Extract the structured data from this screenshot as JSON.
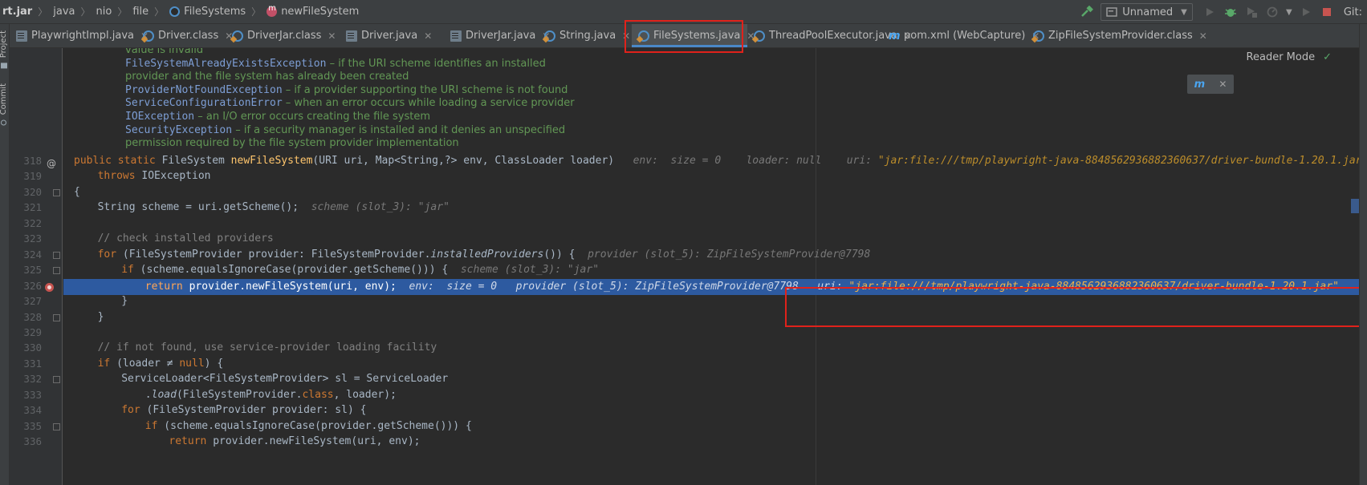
{
  "breadcrumb": [
    "rt.jar",
    "java",
    "nio",
    "file",
    "FileSystems",
    "newFileSystem"
  ],
  "toolbar": {
    "run_config": "Unnamed",
    "git_label": "Git:"
  },
  "side_labels": {
    "project": "Project",
    "commit": "Commit"
  },
  "tabs": [
    {
      "label": "PlaywrightImpl.java",
      "icon": "file"
    },
    {
      "label": "Driver.class",
      "icon": "java"
    },
    {
      "label": "DriverJar.class",
      "icon": "java"
    },
    {
      "label": "Driver.java",
      "icon": "file"
    },
    {
      "label": "DriverJar.java",
      "icon": "file"
    },
    {
      "label": "String.java",
      "icon": "java"
    },
    {
      "label": "FileSystems.java",
      "icon": "java",
      "active": true
    },
    {
      "label": "ThreadPoolExecutor.java",
      "icon": "java"
    },
    {
      "label": "pom.xml (WebCapture)",
      "icon": "maven"
    },
    {
      "label": "ZipFileSystemProvider.class",
      "icon": "java"
    }
  ],
  "reader_mode": "Reader Mode",
  "javadoc": [
    {
      "text": "value is invalid"
    },
    {
      "code": "FileSystemAlreadyExistsException",
      "text": " – if the URI scheme identifies an installed"
    },
    {
      "text": "provider and the file system has already been created"
    },
    {
      "code": "ProviderNotFoundException",
      "text": " – if a provider supporting the URI scheme is not found"
    },
    {
      "code": "ServiceConfigurationError",
      "text": " – when an error occurs while loading a service provider"
    },
    {
      "code": "IOException",
      "text": " – an I/O error occurs creating the file system"
    },
    {
      "code": "SecurityException",
      "text": " – if a security manager is installed and it denies an unspecified"
    },
    {
      "text": "permission required by the file system provider implementation"
    }
  ],
  "line_numbers": [
    "318",
    "319",
    "320",
    "321",
    "322",
    "323",
    "324",
    "325",
    "326",
    "327",
    "328",
    "329",
    "330",
    "331",
    "332",
    "333",
    "334",
    "335",
    "336"
  ],
  "code": {
    "l318": {
      "a": "public static ",
      "b": "FileSystem ",
      "c": "newFileSystem",
      "d": "(URI uri, Map<String,?> env, ClassLoader loader)",
      "hint1": "env:  size = 0",
      "hint2": "loader: null",
      "hint3": "uri: ",
      "hint3s": "\"jar:file:///tmp/playwright-java-8848562936882360637/driver-bundle-1.20.1.jar\""
    },
    "l319": {
      "a": "throws ",
      "b": "IOException"
    },
    "l320": "{",
    "l321": {
      "a": "String scheme = uri.getScheme();",
      "hint": "scheme (slot_3): \"jar\""
    },
    "l323": "// check installed providers",
    "l324": {
      "a": "for ",
      "b": "(FileSystemProvider provider: FileSystemProvider.",
      "c": "installedProviders",
      "d": "()) {",
      "hint": "provider (slot_5): ZipFileSystemProvider@7798"
    },
    "l325": {
      "a": "if ",
      "b": "(scheme.equalsIgnoreCase(provider.getScheme())) {",
      "hint": "scheme (slot_3): \"jar\""
    },
    "l326": {
      "a": "return ",
      "b": "provider.newFileSystem(uri, env);",
      "hint1": "env:  size = 0",
      "hint2": "provider (slot_5): ZipFileSystemProvider@7798",
      "hint3": "uri: ",
      "hint3s": "\"jar:file:///tmp/playwright-java-8848562936882360637/driver-bundle-1.20.1.jar\""
    },
    "l327": "}",
    "l328": "}",
    "l330": "// if not found, use service-provider loading facility",
    "l331": {
      "a": "if ",
      "b": "(loader ",
      "c": "≠ ",
      "d": "null",
      "e": ") {"
    },
    "l332": "ServiceLoader<FileSystemProvider> sl = ServiceLoader",
    "l333": {
      "a": ".",
      "b": "load",
      "c": "(FileSystemProvider.",
      "d": "class",
      "e": ", loader);"
    },
    "l334": {
      "a": "for ",
      "b": "(FileSystemProvider provider: sl) {"
    },
    "l335": {
      "a": "if ",
      "b": "(scheme.equalsIgnoreCase(provider.getScheme())) {"
    },
    "l336": {
      "a": "return ",
      "b": "provider.newFileSystem(uri, env);"
    }
  },
  "colors": {
    "keyword": "#cc7832",
    "method": "#ffc66d",
    "comment": "#808080",
    "highlight": "#2d5aa0",
    "annotation_box": "#e0221b"
  }
}
